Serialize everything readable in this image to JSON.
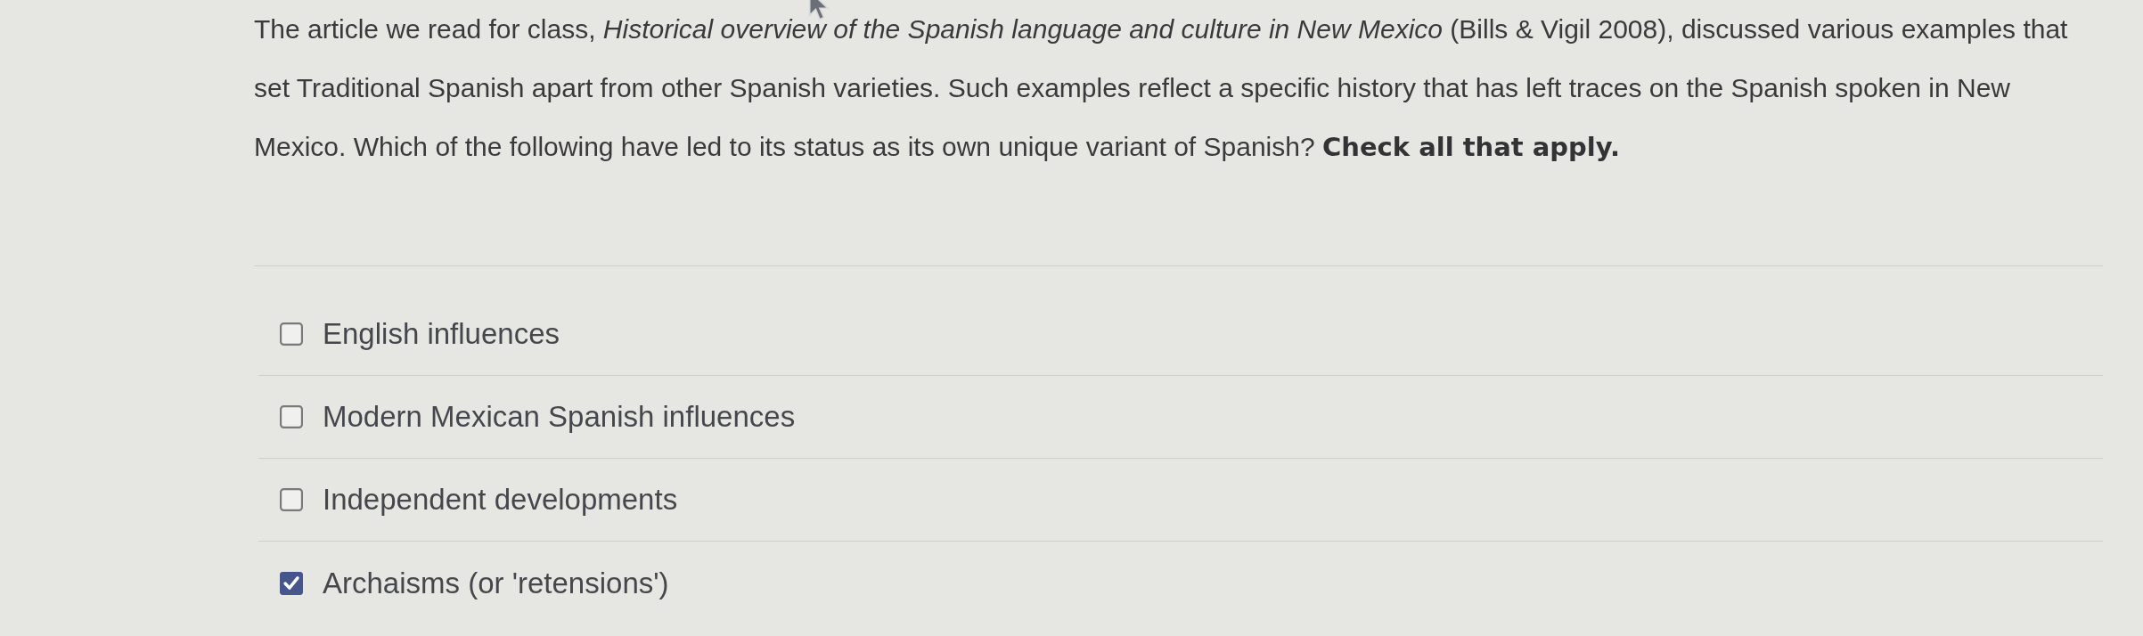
{
  "question": {
    "text": "The article we read for class, *Historical overview of the Spanish language and culture in New Mexico* (Bills & Vigil 2008), discussed various examples that set Traditional Spanish apart from other Spanish varieties. Such examples reflect a specific history that has left traces on the Spanish spoken in New Mexico. Which of the following have led to its status as its own unique variant of Spanish? **Check all that apply.**"
  },
  "options": [
    {
      "label": "English influences",
      "checked": false
    },
    {
      "label": "Modern Mexican Spanish influences",
      "checked": false
    },
    {
      "label": "Independent developments",
      "checked": false
    },
    {
      "label": "Archaisms (or 'retensions')",
      "checked": true
    }
  ]
}
